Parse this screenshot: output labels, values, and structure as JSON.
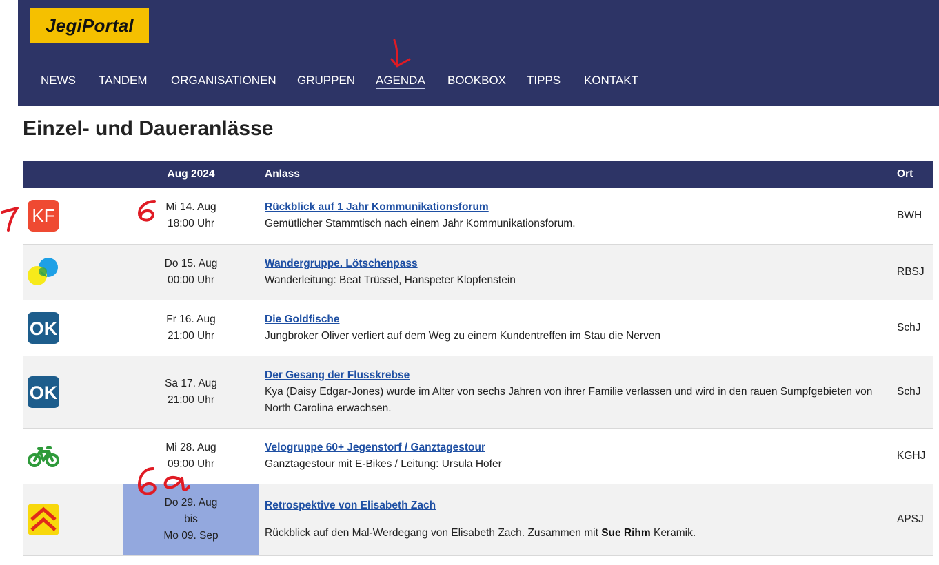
{
  "header": {
    "logo": "JegiPortal",
    "nav": [
      "NEWS",
      "TANDEM",
      "ORGANISATIONEN",
      "GRUPPEN",
      "AGENDA",
      "BOOKBOX",
      "TIPPS",
      "KONTAKT"
    ],
    "active": "AGENDA"
  },
  "page": {
    "title": "Einzel- und Daueranlässe"
  },
  "table": {
    "headers": {
      "icon": "",
      "date": "Aug 2024",
      "event": "Anlass",
      "place": "Ort"
    },
    "rows": [
      {
        "icon": "kf-icon",
        "date1": "Mi 14. Aug",
        "date2": "18:00 Uhr",
        "title": "Rückblick auf 1 Jahr Kommunikationsforum",
        "desc": "Gemütlicher Stammtisch nach einem Jahr Kommunikationsforum.",
        "ort": "BWH"
      },
      {
        "icon": "circles-icon",
        "date1": "Do 15. Aug",
        "date2": "00:00 Uhr",
        "title": "Wandergruppe. Lötschenpass",
        "desc": "Wanderleitung: Beat Trüssel, Hanspeter Klopfenstein",
        "ort": "RBSJ"
      },
      {
        "icon": "ok-icon",
        "date1": "Fr 16. Aug",
        "date2": "21:00 Uhr",
        "title": "Die Goldfische",
        "desc": "Jungbroker Oliver verliert auf dem Weg zu einem Kundentreffen im Stau die Nerven",
        "ort": "SchJ"
      },
      {
        "icon": "ok-icon",
        "date1": "Sa 17. Aug",
        "date2": "21:00 Uhr",
        "title": "Der Gesang der Flusskrebse",
        "desc": "Kya (Daisy Edgar-Jones) wurde im Alter von sechs Jahren von ihrer Familie verlassen und wird in den rauen Sumpfgebieten von North Carolina erwachsen.",
        "ort": "SchJ"
      },
      {
        "icon": "bicycle-icon",
        "date1": "Mi 28. Aug",
        "date2": "09:00 Uhr",
        "title": "Velogruppe 60+ Jegenstorf / Ganztagestour",
        "desc": "Ganztagestour mit E-Bikes / Leitung: Ursula Hofer",
        "ort": "KGHJ"
      },
      {
        "icon": "chevron-up-icon",
        "date1": "Do 29. Aug",
        "date2": "bis",
        "date3": "Mo 09. Sep",
        "title": "Retrospektive von Elisabeth Zach",
        "desc_pre": "Rückblick auf den Mal-Werdegang von Elisabeth Zach. Zusammen mit ",
        "desc_bold": "Sue Rihm",
        "desc_post": " Keramik.",
        "ort": "APSJ"
      }
    ]
  },
  "annotations": {
    "a1": "7",
    "a2": "6",
    "a3": "6a"
  },
  "colors": {
    "header_bg": "#2d3466",
    "logo_bg": "#f5c000",
    "link": "#1e4fa3",
    "highlight": "#93a8de",
    "annotation": "#e01b24"
  }
}
